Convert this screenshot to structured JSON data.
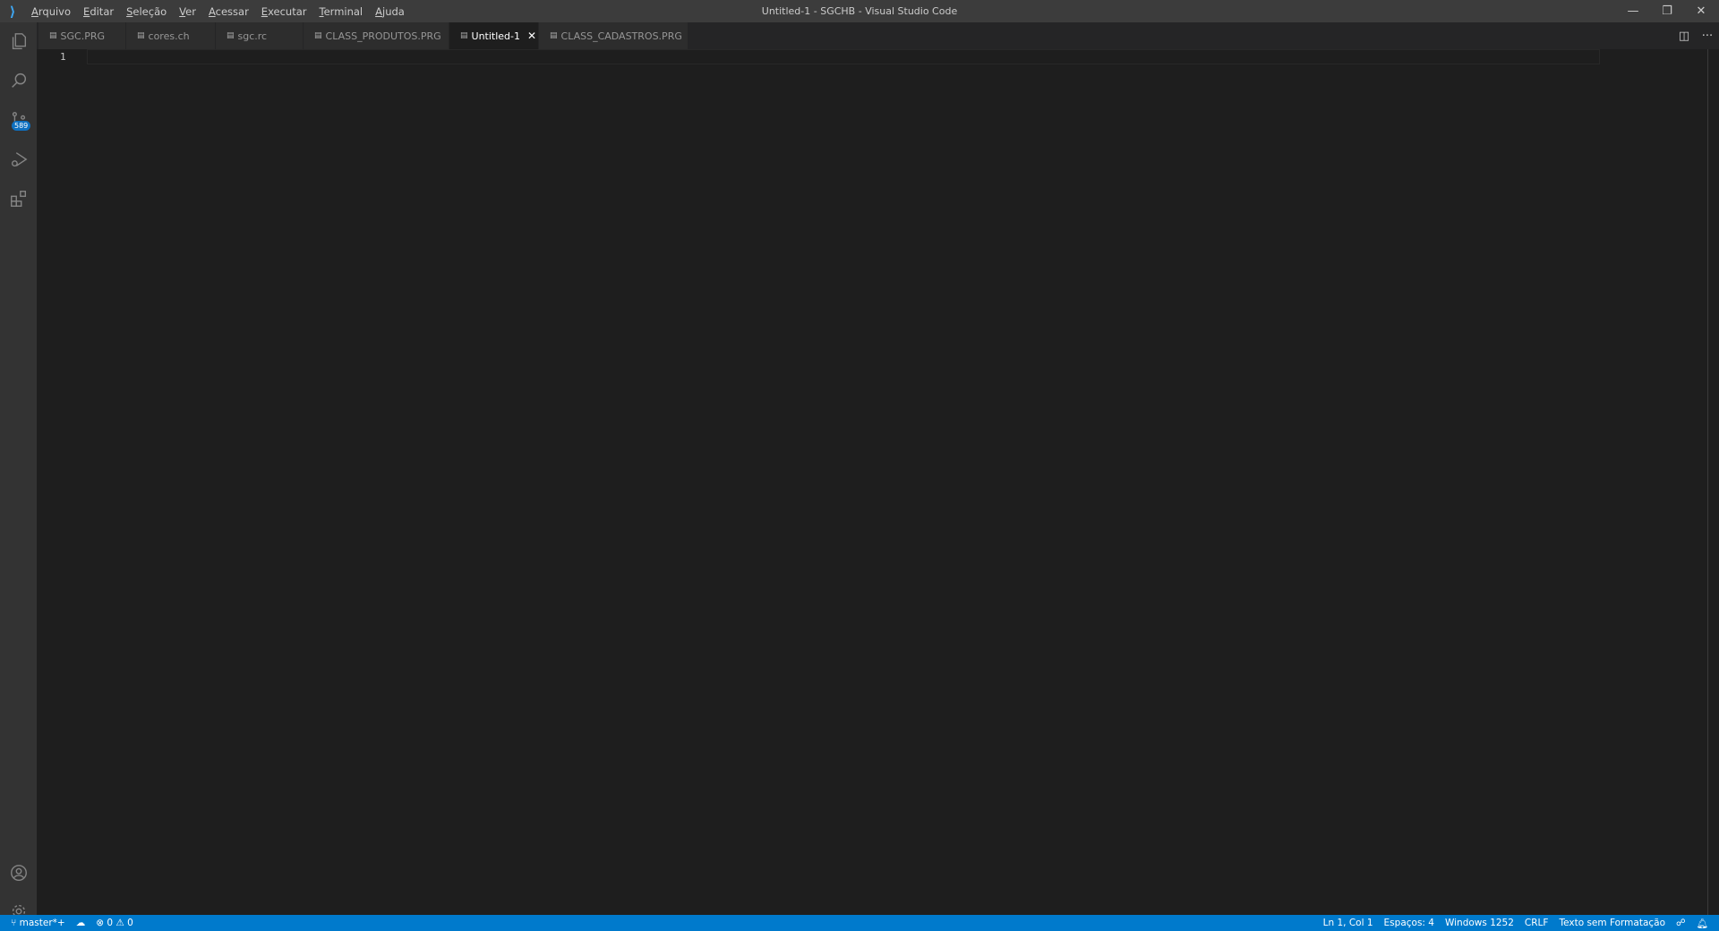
{
  "titlebar": {
    "title": "Untitled-1 - SGCHB - Visual Studio Code",
    "menu": [
      {
        "u": "A",
        "rest": "rquivo"
      },
      {
        "u": "E",
        "rest": "ditar"
      },
      {
        "u": "S",
        "rest": "eleção"
      },
      {
        "u": "V",
        "rest": "er"
      },
      {
        "u": "A",
        "rest": "cessar"
      },
      {
        "u": "E",
        "rest": "xecutar"
      },
      {
        "u": "T",
        "rest": "erminal"
      },
      {
        "u": "A",
        "rest": "juda"
      }
    ]
  },
  "activity": {
    "scm_badge": "589"
  },
  "tabs": [
    {
      "label": "SGC.PRG"
    },
    {
      "label": "cores.ch"
    },
    {
      "label": "sgc.rc"
    },
    {
      "label": "CLASS_PRODUTOS.PRG"
    },
    {
      "label": "Untitled-1",
      "active": true
    },
    {
      "label": "CLASS_CADASTROS.PRG"
    }
  ],
  "editor": {
    "line_number": "1"
  },
  "status": {
    "branch": "master*+",
    "errors": "0",
    "warnings": "0",
    "position": "Ln 1, Col 1",
    "spaces": "Espaços: 4",
    "encoding": "Windows 1252",
    "eol": "CRLF",
    "language": "Texto sem Formatação"
  },
  "colors": {
    "accent": "#007acc"
  }
}
